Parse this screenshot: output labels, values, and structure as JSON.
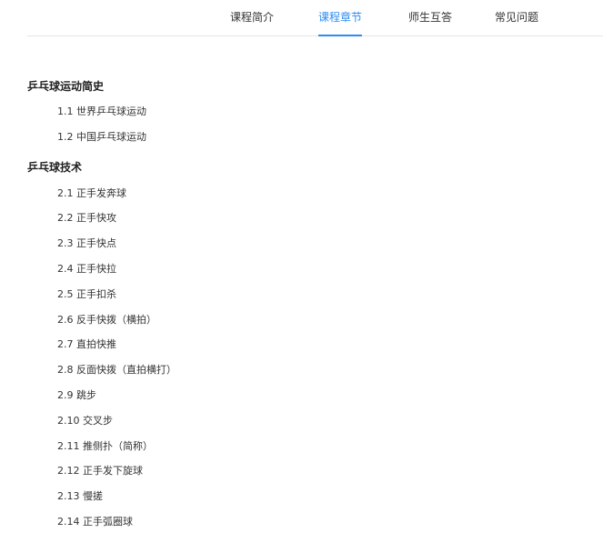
{
  "tabs": [
    {
      "label": "课程简介"
    },
    {
      "label": "课程章节"
    },
    {
      "label": "师生互答"
    },
    {
      "label": "常见问题"
    }
  ],
  "active_tab": "课程章节",
  "accent_color": "#2d8cf0",
  "chapters": [
    {
      "title": "乒乓球运动简史",
      "lessons": [
        {
          "label": "1.1 世界乒乓球运动"
        },
        {
          "label": "1.2 中国乒乓球运动"
        }
      ]
    },
    {
      "title": "乒乓球技术",
      "lessons": [
        {
          "label": "2.1 正手发奔球"
        },
        {
          "label": "2.2 正手快攻"
        },
        {
          "label": "2.3 正手快点"
        },
        {
          "label": "2.4 正手快拉"
        },
        {
          "label": "2.5 正手扣杀"
        },
        {
          "label": "2.6 反手快拨（横拍）"
        },
        {
          "label": "2.7 直拍快推"
        },
        {
          "label": "2.8 反面快拨（直拍横打）"
        },
        {
          "label": "2.9 跳步"
        },
        {
          "label": "2.10 交叉步"
        },
        {
          "label": "2.11 推侧扑（简称）"
        },
        {
          "label": "2.12 正手发下旋球"
        },
        {
          "label": "2.13 慢搓"
        },
        {
          "label": "2.14 正手弧圈球"
        }
      ]
    }
  ]
}
